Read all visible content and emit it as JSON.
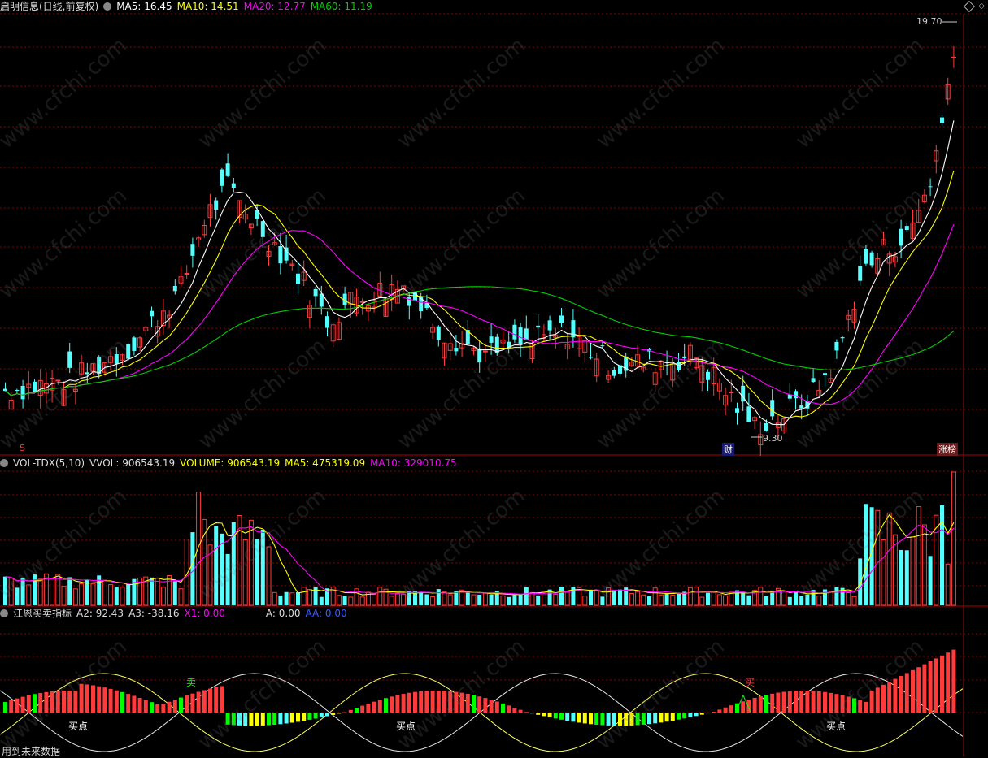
{
  "main": {
    "title": "启明信息(日线,前复权)",
    "ma5": "MA5: 16.45",
    "ma10": "MA10: 14.51",
    "ma20": "MA20: 12.77",
    "ma60": "MA60: 11.19",
    "high_label": "19.70",
    "low_label": "9.30",
    "marker_s": "S",
    "marker_cai": "财",
    "marker_zhangtingbang": "涨榜"
  },
  "vol": {
    "name": "VOL-TDX(5,10)",
    "vvol": "VVOL: 906543.19",
    "volume": "VOLUME: 906543.19",
    "ma5": "MA5: 475319.09",
    "ma10": "MA10: 329010.75"
  },
  "ind": {
    "name": "江恩买卖指标",
    "a2": "A2: 92.43",
    "a3": "A3: -38.16",
    "x1": "X1: 0.00",
    "a": "A: 0.00",
    "aa": "AA: 0.00",
    "sell_label": "卖",
    "buy_label": "买",
    "buy_point": "买点"
  },
  "footer": "用到未来数据",
  "watermark": "www.cfchi.com",
  "colors": {
    "up": "#ff3b3b",
    "down": "#54ffff",
    "ma5": "#ffffff",
    "ma10": "#ffff00",
    "ma20": "#ff00ff",
    "ma60": "#00d000",
    "grid": "#8b0000"
  },
  "chart_data": [
    {
      "type": "candlestick",
      "title": "启明信息(日线,前复权)",
      "note": "daily candlesticks with MA5/MA10/MA20/MA60",
      "y_annotations": {
        "max": 19.7,
        "min": 9.3
      },
      "series": [
        {
          "name": "MA5",
          "last": 16.45
        },
        {
          "name": "MA10",
          "last": 14.51
        },
        {
          "name": "MA20",
          "last": 12.77
        },
        {
          "name": "MA60",
          "last": 11.19
        }
      ]
    },
    {
      "type": "bar",
      "title": "VOL-TDX(5,10)",
      "series": [
        {
          "name": "VVOL",
          "last": 906543.19
        },
        {
          "name": "VOLUME",
          "last": 906543.19
        },
        {
          "name": "MA5",
          "last": 475319.09
        },
        {
          "name": "MA10",
          "last": 329010.75
        }
      ]
    },
    {
      "type": "bar",
      "title": "江恩买卖指标",
      "series": [
        {
          "name": "A2",
          "last": 92.43
        },
        {
          "name": "A3",
          "last": -38.16
        },
        {
          "name": "X1",
          "last": 0.0
        },
        {
          "name": "A",
          "last": 0.0
        },
        {
          "name": "AA",
          "last": 0.0
        }
      ]
    }
  ]
}
